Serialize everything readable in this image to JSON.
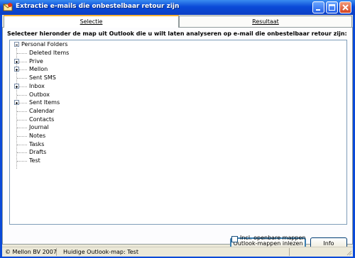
{
  "window": {
    "title": "Extractie e-mails die onbestelbaar retour zijn"
  },
  "tabs": [
    {
      "label": "Selectie",
      "active": true
    },
    {
      "label": "Resultaat",
      "active": false
    }
  ],
  "selectie": {
    "heading": "Selecteer hieronder de map uit Outlook die u wilt laten analyseren op e-mail die onbestelbaar retour zijn:",
    "tree": {
      "root": {
        "label": "Personal Folders",
        "expanded": true
      },
      "children": [
        {
          "label": "Deleted Items",
          "has_children": false
        },
        {
          "label": "Prive",
          "has_children": true
        },
        {
          "label": "Mellon",
          "has_children": true
        },
        {
          "label": "Sent SMS",
          "has_children": false
        },
        {
          "label": "Inbox",
          "has_children": true
        },
        {
          "label": "Outbox",
          "has_children": false
        },
        {
          "label": "Sent Items",
          "has_children": true
        },
        {
          "label": "Calendar",
          "has_children": false
        },
        {
          "label": "Contacts",
          "has_children": false
        },
        {
          "label": "Journal",
          "has_children": false
        },
        {
          "label": "Notes",
          "has_children": false
        },
        {
          "label": "Tasks",
          "has_children": false
        },
        {
          "label": "Drafts",
          "has_children": false
        },
        {
          "label": "Test",
          "has_children": false
        }
      ]
    },
    "buttons": {
      "read_folders": "Outlook-mappen inlezen",
      "info": "Info"
    },
    "checkbox": {
      "label": "Incl. openbare mappen",
      "checked": false
    }
  },
  "statusbar": {
    "copyright": "© Mellon BV 2007",
    "current_folder": "Huidige Outlook-map: Test"
  },
  "colors": {
    "titlebar": "#0a4ad8",
    "tab_highlight": "#f8b335",
    "close_button": "#d54420"
  }
}
